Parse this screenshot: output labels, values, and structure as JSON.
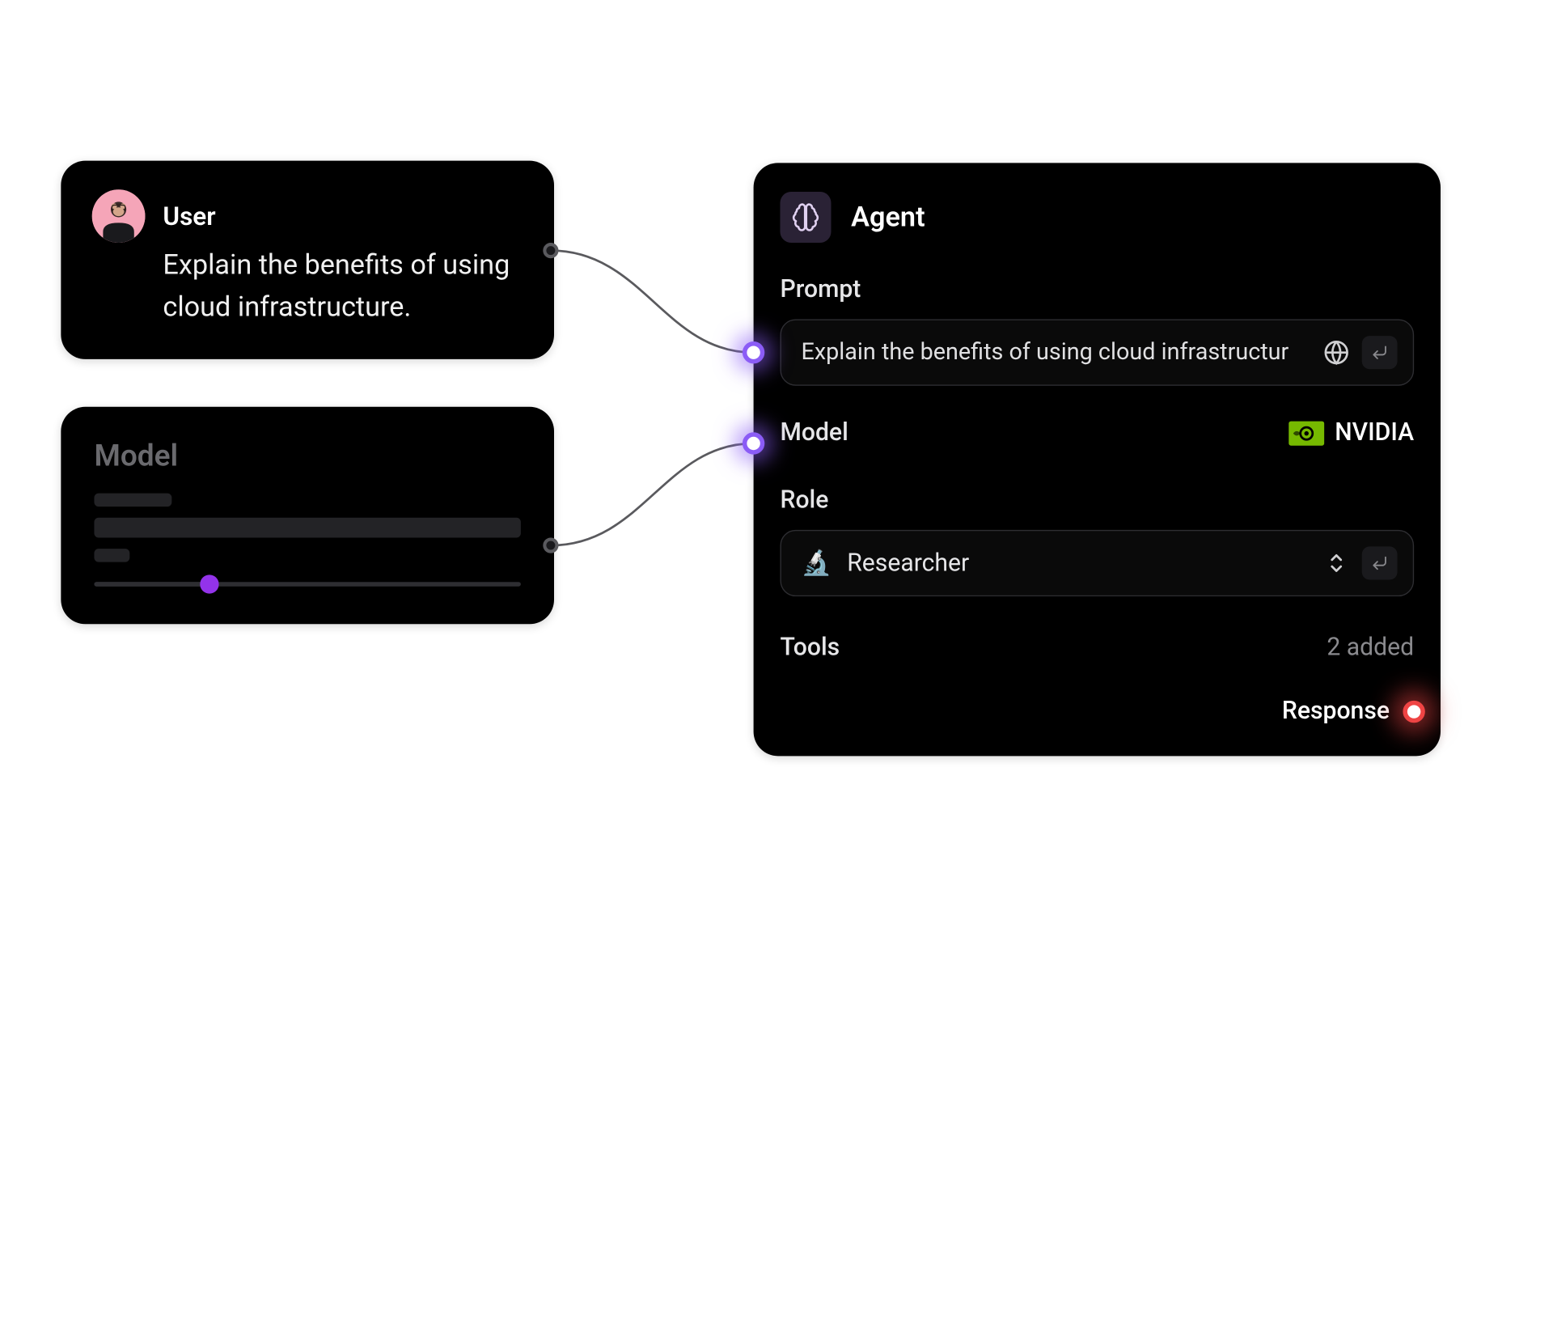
{
  "user": {
    "title": "User",
    "message": "Explain the benefits of using cloud infrastructure."
  },
  "model_card": {
    "title": "Model",
    "slider_percent": 27
  },
  "agent": {
    "title": "Agent",
    "prompt": {
      "label": "Prompt",
      "value": "Explain the benefits of using cloud infrastructur"
    },
    "model": {
      "label": "Model",
      "provider": "NVIDIA"
    },
    "role": {
      "label": "Role",
      "icon": "🔬",
      "value": "Researcher"
    },
    "tools": {
      "label": "Tools",
      "count_text": "2 added"
    },
    "response": {
      "label": "Response"
    }
  },
  "colors": {
    "purple": "#8b5cf6",
    "red": "#ef4444",
    "nvidia_green": "#76b900"
  }
}
